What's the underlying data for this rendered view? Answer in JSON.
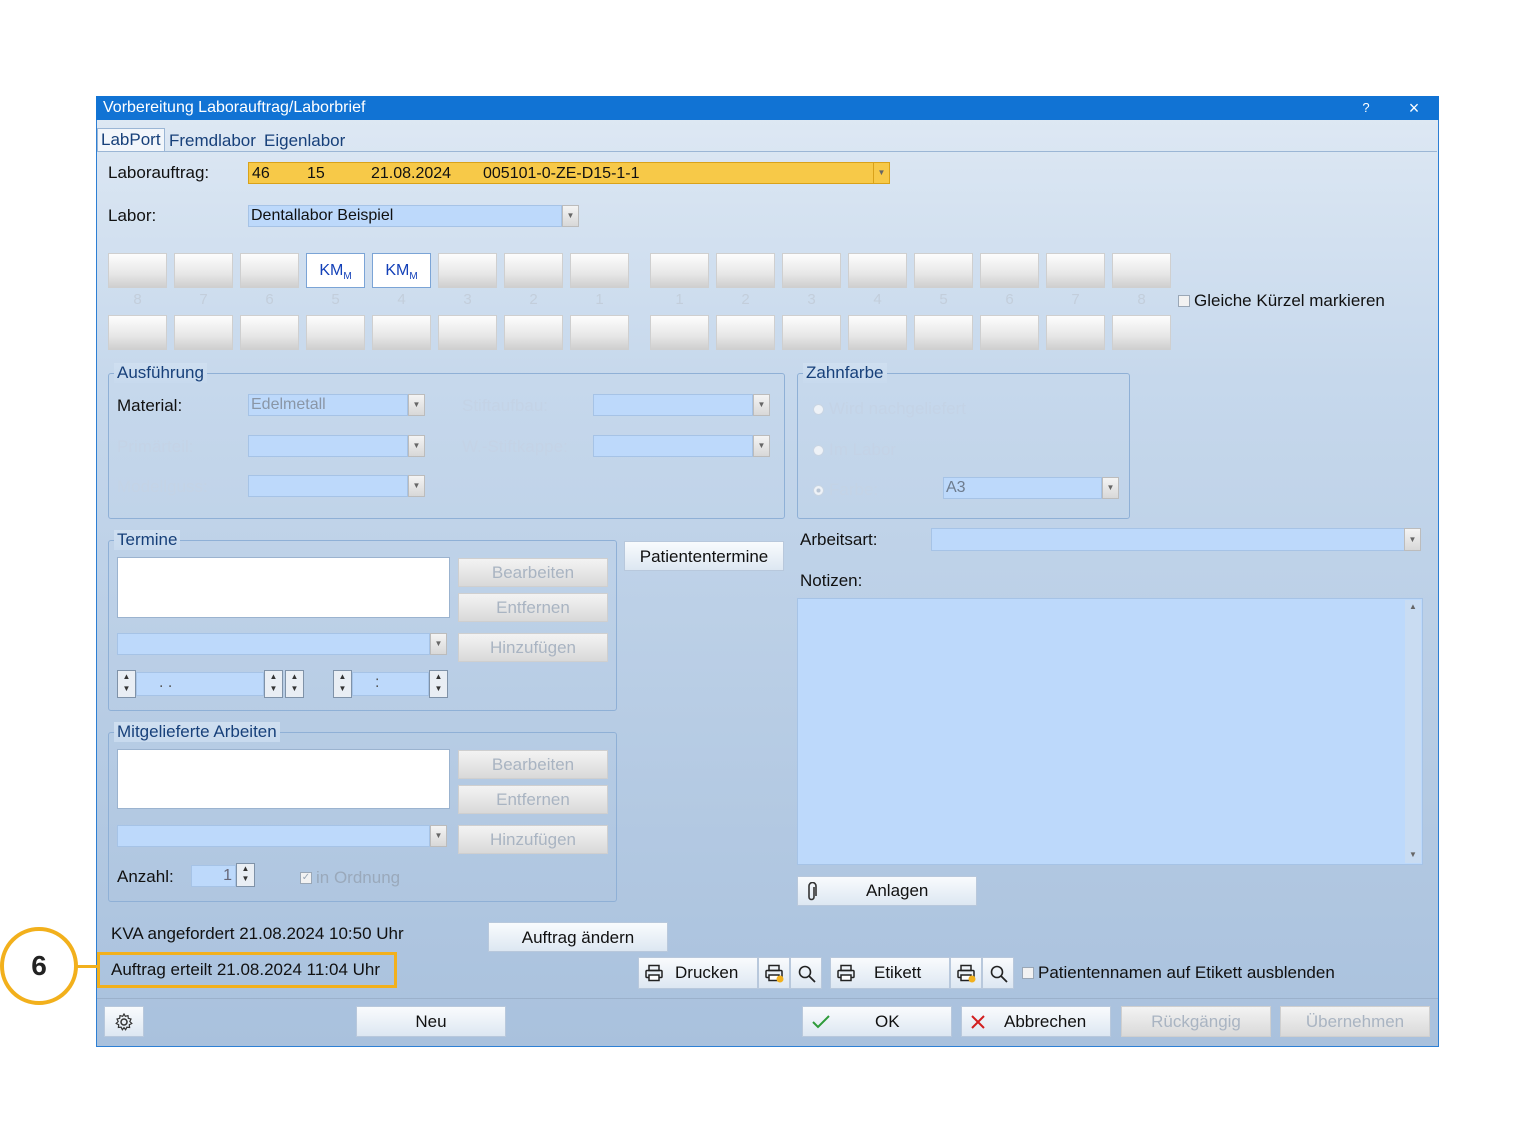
{
  "window": {
    "title": "Vorbereitung Laborauftrag/Laborbrief",
    "help_label": "?",
    "close_label": "×"
  },
  "tabs": [
    {
      "label": "LabPort"
    },
    {
      "label": "Fremdlabor"
    },
    {
      "label": "Eigenlabor"
    }
  ],
  "laborauftrag": {
    "label": "Laborauftrag:",
    "number": "46",
    "count": "15",
    "date": "21.08.2024",
    "code": "005101-0-ZE-D15-1-1",
    "highlight_color": "#f7c948"
  },
  "labor": {
    "label": "Labor:",
    "value": "Dentallabor Beispiel"
  },
  "teeth": {
    "upper_left_numbers": [
      "8",
      "7",
      "6",
      "5",
      "4",
      "3",
      "2",
      "1"
    ],
    "upper_right_numbers": [
      "1",
      "2",
      "3",
      "4",
      "5",
      "6",
      "7",
      "8"
    ],
    "upper_left_codes": [
      "",
      "",
      "",
      "KM",
      "KM",
      "",
      "",
      ""
    ],
    "code_subscript": "M",
    "same_marks_label": "Gleiche Kürzel markieren"
  },
  "ausfuehrung": {
    "title": "Ausführung",
    "material_label": "Material:",
    "material_value": "Edelmetall",
    "primaerteil_label": "Primärteil:",
    "modellguss_label": "Modellguss:",
    "stiftaufbau_label": "Stiftaufbau:",
    "stiftkappe_label": "W.-Stiftkappe:"
  },
  "zahnfarbe": {
    "title": "Zahnfarbe",
    "option1": "Wird nachgeliefert",
    "option2": "Im Labor",
    "option3": "Farbe:",
    "farbe_value": "A3"
  },
  "termine": {
    "title": "Termine",
    "edit": "Bearbeiten",
    "remove": "Entfernen",
    "add": "Hinzufügen",
    "date_placeholder": ". .",
    "time_placeholder": ":",
    "patient_dates_button": "Patiententermine"
  },
  "mitgeliefert": {
    "title": "Mitgelieferte Arbeiten",
    "edit": "Bearbeiten",
    "remove": "Entfernen",
    "add": "Hinzufügen",
    "count_label": "Anzahl:",
    "count_value": "1",
    "in_order_label": "in Ordnung"
  },
  "right": {
    "arbeitsart_label": "Arbeitsart:",
    "notizen_label": "Notizen:",
    "anlagen_button": "Anlagen"
  },
  "status": {
    "kva": "KVA angefordert 21.08.2024 10:50 Uhr",
    "auftrag": "Auftrag erteilt 21.08.2024 11:04 Uhr",
    "change_button": "Auftrag ändern"
  },
  "print": {
    "drucken": "Drucken",
    "etikett": "Etikett",
    "hide_names_label": "Patientennamen auf Etikett ausblenden"
  },
  "footer": {
    "neu": "Neu",
    "ok": "OK",
    "abbrechen": "Abbrechen",
    "rueckgaengig": "Rückgängig",
    "uebernehmen": "Übernehmen"
  },
  "annotation": {
    "number": "6",
    "color": "#f2b01c"
  }
}
